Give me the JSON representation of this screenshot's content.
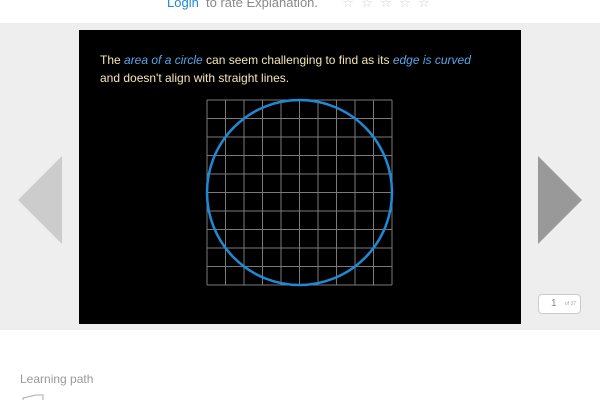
{
  "rating": {
    "login_label": "Login",
    "rate_label": "to rate Explanation.",
    "stars": [
      "☆",
      "☆",
      "☆",
      "☆",
      "☆"
    ]
  },
  "slide": {
    "text_before": "The ",
    "highlight_1": "area of a circle",
    "text_middle": " can seem challenging to find as its ",
    "highlight_2": "edge is curved",
    "text_after": "and doesn't align with straight lines.",
    "grid_cells": 10,
    "colors": {
      "background": "#000000",
      "text": "#f4e6b4",
      "highlight": "#55a6e8",
      "grid": "#7a7a7a",
      "circle": "#1e8ad6"
    }
  },
  "pager": {
    "current": "1",
    "of_label": "of 37"
  },
  "learning_path": {
    "title": "Learning path"
  },
  "icons": {
    "prev": "chevron-left-icon",
    "next": "chevron-right-icon",
    "star": "star-outline-icon",
    "learning_path": "folder-icon"
  }
}
